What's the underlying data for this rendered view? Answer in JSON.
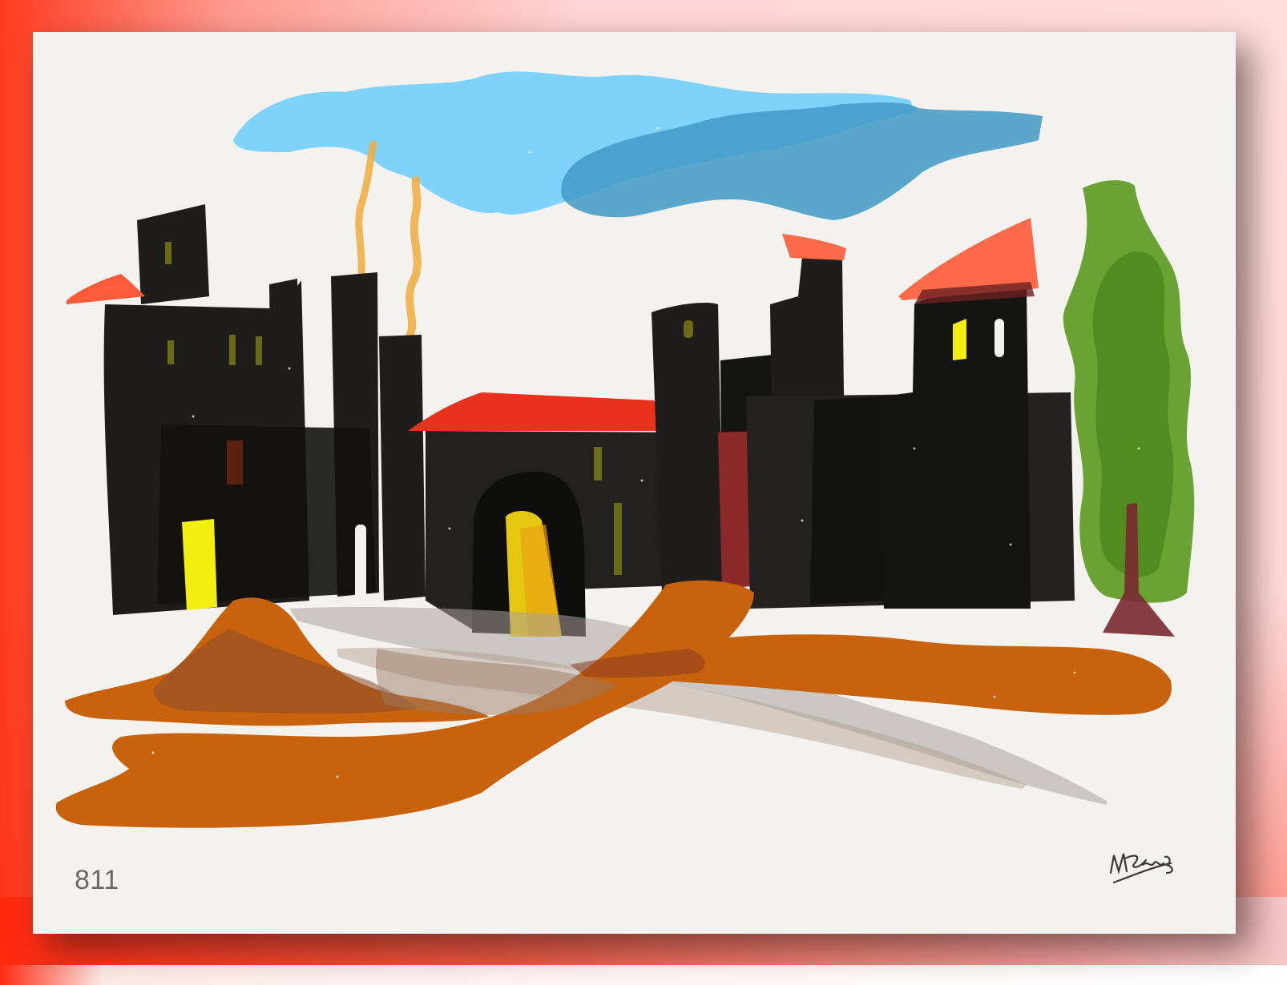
{
  "artwork": {
    "number": "811",
    "signature": "artist-signature"
  },
  "colors": {
    "paper": "#f4f2ef",
    "buildings": "#1e1d1b",
    "sky_light": "#7fd3fb",
    "sky_dark": "#3f9ac5",
    "roof_red": "#e8321c",
    "roof_salmon": "#ff6a4a",
    "ground_orange": "#c8620d",
    "window_yellow": "#f2ee10",
    "tree_green": "#5b9a1e",
    "smoke": "#f0ac3c",
    "brown": "#8a2a2a",
    "path_gray": "#a8a29a"
  }
}
